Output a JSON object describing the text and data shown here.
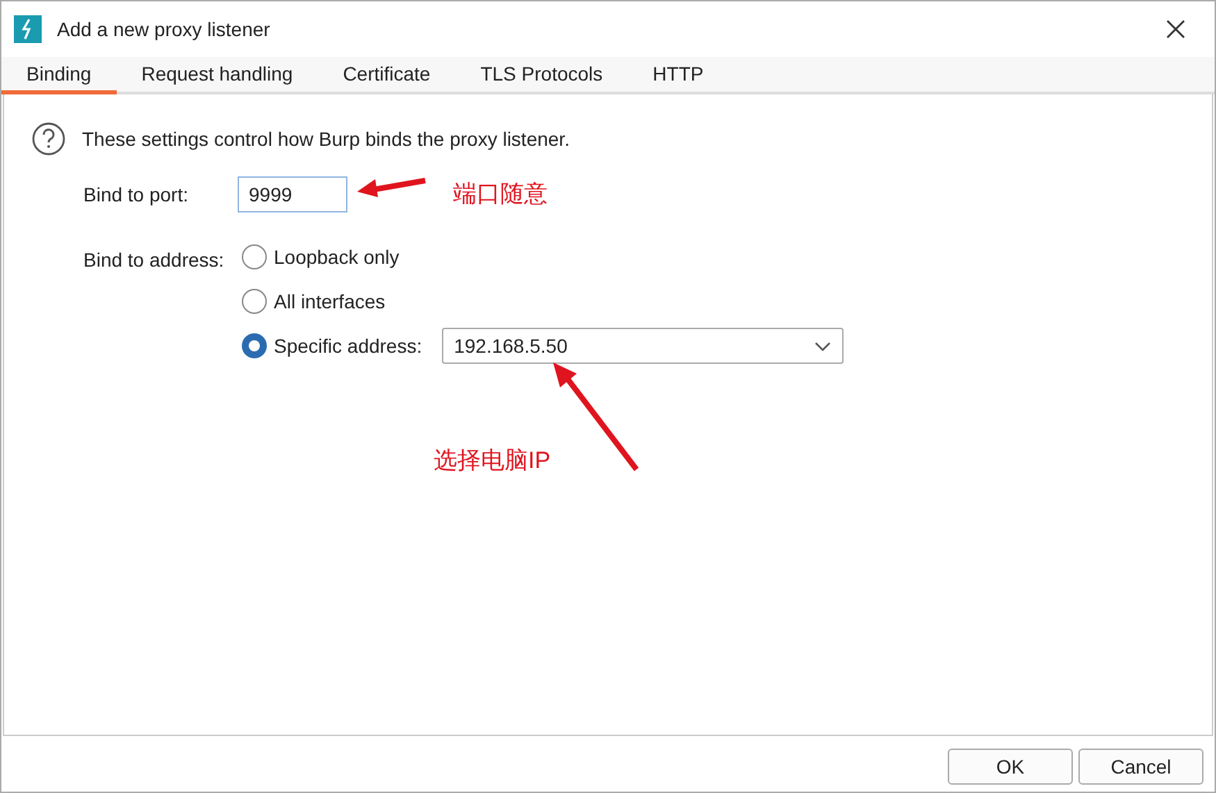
{
  "window": {
    "title": "Add a new proxy listener"
  },
  "tabs": [
    {
      "label": "Binding",
      "selected": true
    },
    {
      "label": "Request handling",
      "selected": false
    },
    {
      "label": "Certificate",
      "selected": false
    },
    {
      "label": "TLS Protocols",
      "selected": false
    },
    {
      "label": "HTTP",
      "selected": false
    }
  ],
  "info": "These settings control how Burp binds the proxy listener.",
  "port": {
    "label": "Bind to port:",
    "value": "9999"
  },
  "address": {
    "label": "Bind to address:",
    "options": [
      {
        "label": "Loopback only",
        "selected": false
      },
      {
        "label": "All interfaces",
        "selected": false
      },
      {
        "label": "Specific address:",
        "selected": true,
        "value": "192.168.5.50"
      }
    ]
  },
  "annotations": [
    "端口随意",
    "选择电脑IP"
  ],
  "buttons": [
    "OK",
    "Cancel"
  ]
}
